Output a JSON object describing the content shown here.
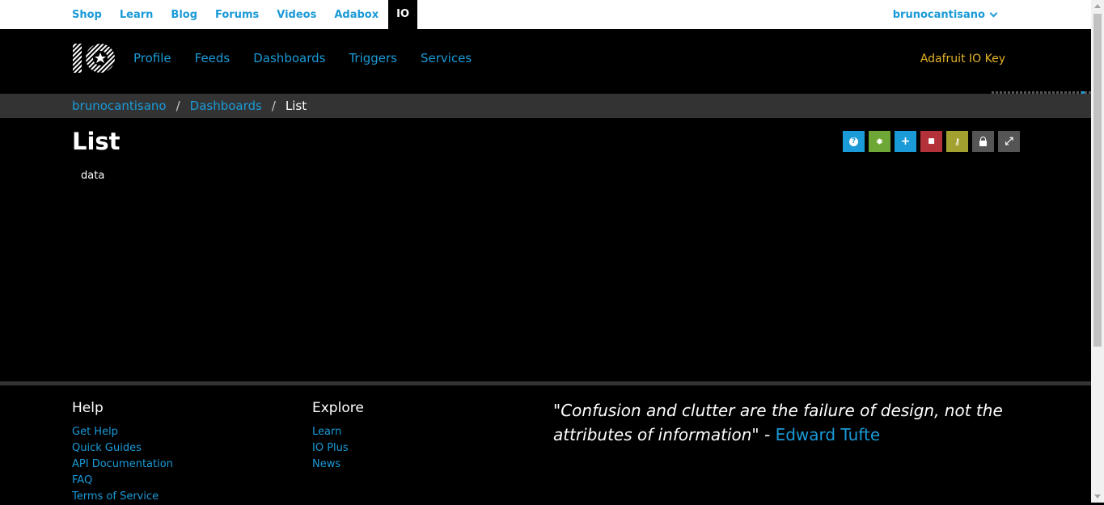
{
  "topnav": {
    "links": [
      "Shop",
      "Learn",
      "Blog",
      "Forums",
      "Videos",
      "Adabox"
    ],
    "active": "IO",
    "user": "brunocantisano"
  },
  "ionav": {
    "links": [
      "Profile",
      "Feeds",
      "Dashboards",
      "Triggers",
      "Services"
    ],
    "key_label": "Adafruit IO Key"
  },
  "breadcrumb": {
    "user": "brunocantisano",
    "section": "Dashboards",
    "current": "List"
  },
  "page": {
    "title": "List",
    "feed_label": "data"
  },
  "toolbar": [
    {
      "icon": "help-icon",
      "glyph": "?",
      "color": "#1a9ad7"
    },
    {
      "icon": "gear-icon",
      "glyph": "✹",
      "color": "#6ea735"
    },
    {
      "icon": "plus-icon",
      "glyph": "+",
      "color": "#1a9ad7"
    },
    {
      "icon": "trash-icon",
      "glyph": "■",
      "color": "#b3323a"
    },
    {
      "icon": "key-icon",
      "glyph": "⚷",
      "color": "#a2a130"
    },
    {
      "icon": "lock-icon",
      "glyph": "🔒",
      "color": "#555555"
    },
    {
      "icon": "expand-icon",
      "glyph": "⤢",
      "color": "#555555"
    }
  ],
  "footer": {
    "help": {
      "title": "Help",
      "links": [
        "Get Help",
        "Quick Guides",
        "API Documentation",
        "FAQ",
        "Terms of Service"
      ]
    },
    "explore": {
      "title": "Explore",
      "links": [
        "Learn",
        "IO Plus",
        "News"
      ]
    },
    "quote": {
      "text": "\"Confusion and clutter are the failure of design, not the attributes of information\" - ",
      "author": "Edward Tufte"
    }
  },
  "colors": {
    "link": "#1a9ad7",
    "key": "#e4b327"
  }
}
